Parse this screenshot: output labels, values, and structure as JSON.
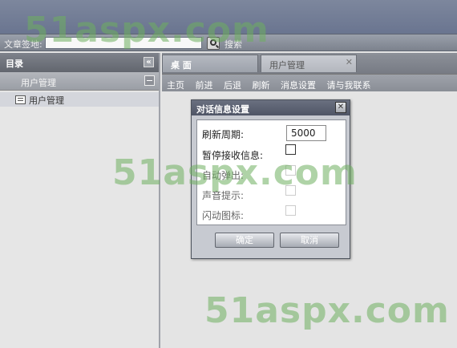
{
  "address_bar": {
    "label": "文章签地:",
    "search_label": "搜索"
  },
  "sidebar": {
    "title": "目录",
    "collapse_icon": "«",
    "group": "用户管理",
    "items": [
      {
        "label": "用户管理"
      }
    ]
  },
  "tabs": [
    {
      "label": "桌    面",
      "active": true
    },
    {
      "label": "用户管理",
      "active": false,
      "close": "✕"
    }
  ],
  "toolbar": [
    "主页",
    "前进",
    "后退",
    "刷新",
    "消息设置",
    "请与我联系"
  ],
  "dialog": {
    "title": "对话信息设置",
    "close": "✕",
    "refresh_label": "刷新周期:",
    "refresh_value": "5000",
    "pause_label": "暂停接收信息:",
    "popup_label": "自动弹出:",
    "sound_label": "声音提示:",
    "flash_label": "闪动图标:",
    "ok_label": "确定",
    "cancel_label": "取消"
  },
  "watermark": "51aspx.com"
}
